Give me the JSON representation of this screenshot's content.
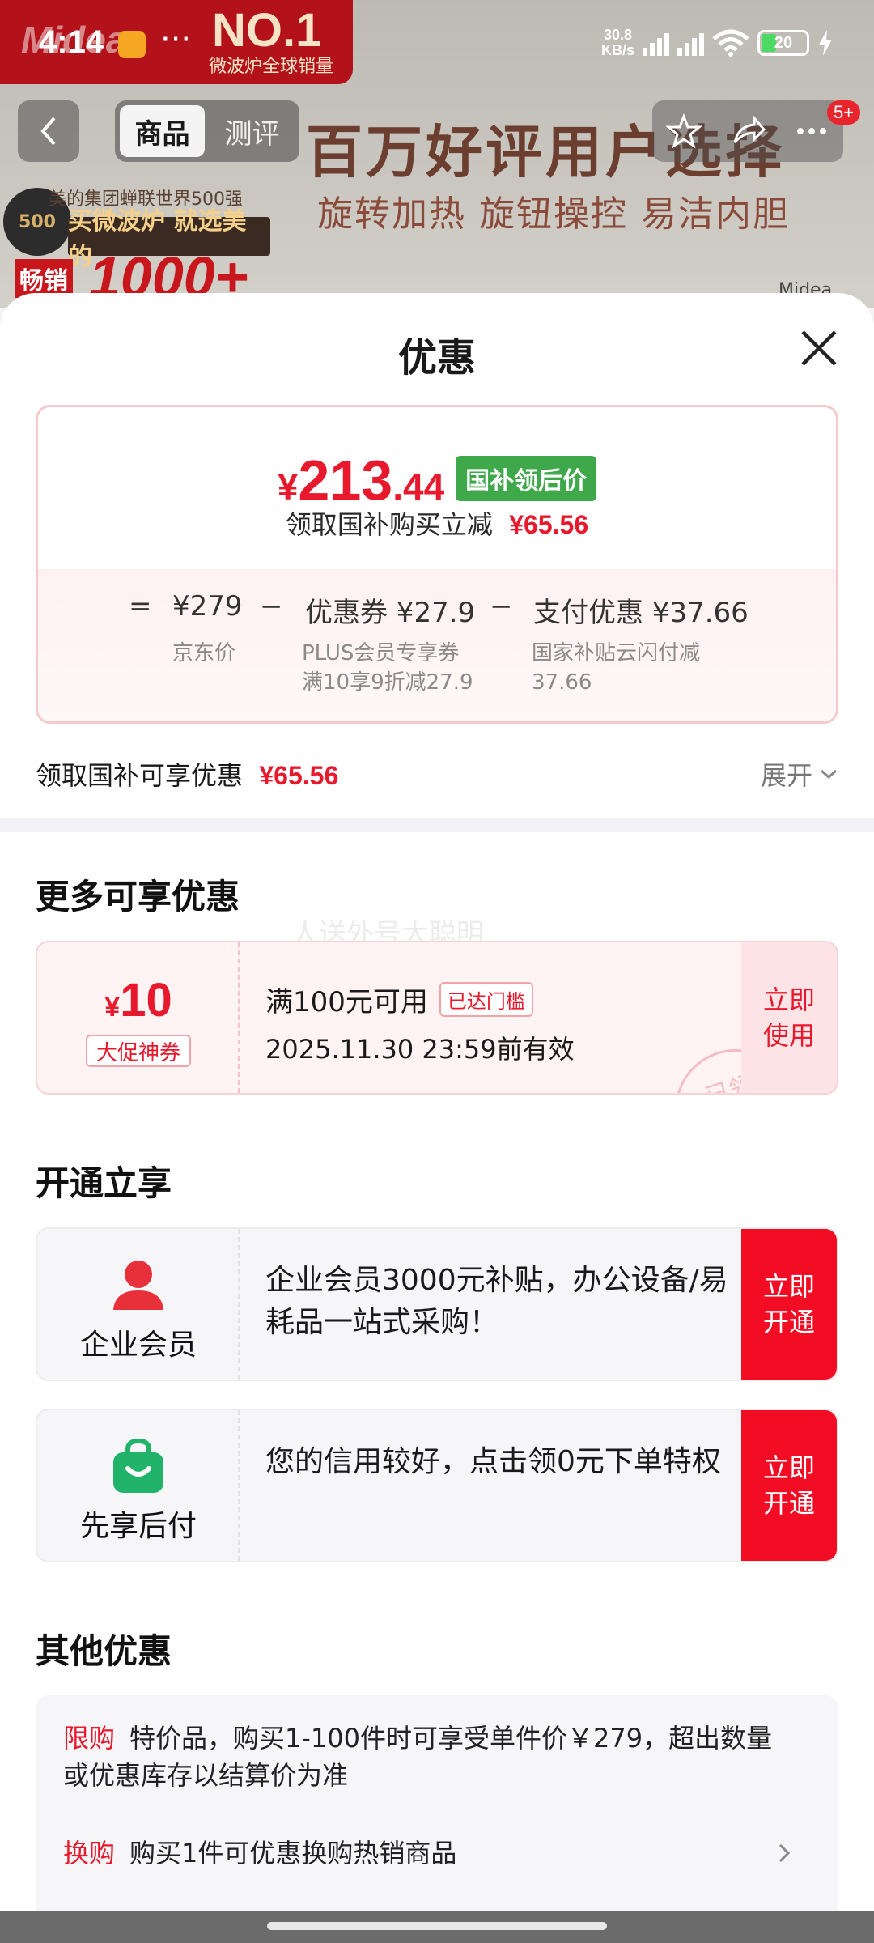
{
  "status_bar": {
    "time": "4:14",
    "net_speed_value": "30.8",
    "net_speed_unit": "KB/s",
    "battery": "20"
  },
  "banner": {
    "brand": "Midea",
    "no1": "NO.1",
    "no1_sub": "微波炉全球销量",
    "headline": "百万好评用户选择",
    "subline": "旋转加热 旋钮操控 易洁内胆",
    "badge_circle": "500",
    "badge_text": "美的集团蝉联世界500强",
    "badge_slogan": "买微波炉 就选美的",
    "hot_label": "畅销",
    "hot_number": "1000+",
    "brand_small": "Midea"
  },
  "top_nav": {
    "tabs": [
      "商品",
      "测评"
    ],
    "active_tab": 0,
    "more_badge": "5+"
  },
  "sheet": {
    "title": "优惠",
    "price": {
      "currency": "¥",
      "integer": "213",
      "decimal": ".44",
      "tag": "国补领后价",
      "sub_label": "领取国补购买立减",
      "sub_amount": "¥65.56"
    },
    "breakdown": {
      "eq": "=",
      "base_price": "¥279",
      "base_label": "京东价",
      "minus1": "−",
      "coupon_value": "优惠券 ¥27.9",
      "coupon_label_1": "PLUS会员专享券",
      "coupon_label_2": "满10享9折减27.9",
      "minus2": "−",
      "pay_value": "支付优惠 ¥37.66",
      "pay_label_1": "国家补贴云闪付减",
      "pay_label_2": "37.66"
    },
    "claim": {
      "label": "领取国补可享优惠",
      "amount": "¥65.56",
      "expand": "展开"
    },
    "more_section": {
      "title": "更多可享优惠",
      "coupon": {
        "currency": "¥",
        "amount": "10",
        "type": "大促神券",
        "condition": "满100元可用",
        "status": "已达门槛",
        "validity": "2025.11.30 23:59前有效",
        "action": "立即使用",
        "stamp": "已领"
      }
    },
    "open_section": {
      "title": "开通立享",
      "items": [
        {
          "label": "企业会员",
          "desc": "企业会员3000元补贴，办公设备/易耗品一站式采购！",
          "action": "立即开通",
          "icon_color": "#e8303a"
        },
        {
          "label": "先享后付",
          "desc": "您的信用较好，点击领0元下单特权",
          "action": "立即开通",
          "icon_color": "#22b36b"
        }
      ]
    },
    "other_section": {
      "title": "其他优惠",
      "lines": [
        {
          "tag": "限购",
          "text": "特价品，购买1-100件时可享受单件价￥279，超出数量或优惠库存以结算价为准"
        },
        {
          "tag": "换购",
          "text": "购买1件可优惠换购热销商品"
        }
      ]
    },
    "watermark": "人送外号大聪明"
  },
  "colors": {
    "accent_red": "#e8192c",
    "green_tag": "#3ea84a",
    "cta_red": "#f20d24"
  }
}
